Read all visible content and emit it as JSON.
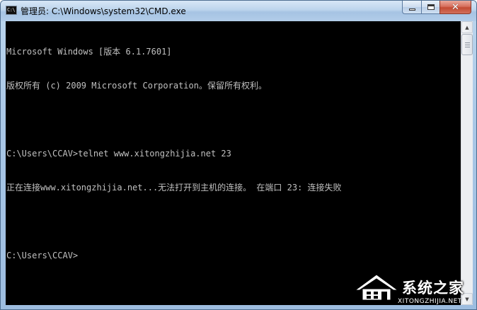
{
  "window": {
    "title": "管理员: C:\\Windows\\system32\\CMD.exe",
    "icon_label": "C:\\",
    "buttons": {
      "minimize": "minimize-icon",
      "maximize": "maximize-icon",
      "close": "✕"
    }
  },
  "console": {
    "lines": [
      "Microsoft Windows [版本 6.1.7601]",
      "版权所有 (c) 2009 Microsoft Corporation。保留所有权利。",
      "",
      "C:\\Users\\CCAV>telnet www.xitongzhijia.net 23",
      "正在连接www.xitongzhijia.net...无法打开到主机的连接。 在端口 23: 连接失败",
      "",
      "C:\\Users\\CCAV>"
    ],
    "text_color": "#c0c0c0",
    "background": "#000000"
  },
  "scrollbar": {
    "up_arrow": "▲",
    "down_arrow": "▼"
  },
  "watermark": {
    "brand": "系统之家",
    "domain": "XITONGZHIJIA.NET"
  }
}
